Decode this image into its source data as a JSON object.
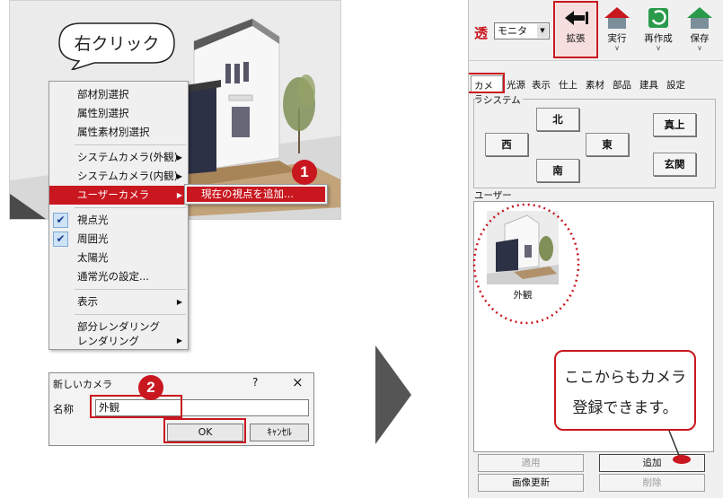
{
  "bubble": {
    "text": "右クリック"
  },
  "context_menu": {
    "items": [
      {
        "label": "部材別選択"
      },
      {
        "label": "属性別選択"
      },
      {
        "label": "属性素材別選択"
      },
      {
        "label": "システムカメラ(外観)",
        "submenu": true
      },
      {
        "label": "システムカメラ(内観)",
        "submenu": true
      },
      {
        "label": "ユーザーカメラ",
        "submenu": true,
        "selected": true
      },
      {
        "label": "視点光",
        "checked": true
      },
      {
        "label": "周囲光",
        "checked": true
      },
      {
        "label": "太陽光"
      },
      {
        "label": "通常光の設定..."
      },
      {
        "label": "表示",
        "submenu": true
      },
      {
        "label": "部分レンダリング"
      },
      {
        "label": "レンダリング",
        "submenu": true
      }
    ],
    "submenu_item": "現在の視点を追加..."
  },
  "markers": {
    "step1": "1",
    "step2": "2"
  },
  "dialog": {
    "title": "新しいカメラ",
    "help": "?",
    "close": "×",
    "name_label": "名称",
    "name_value": "外観",
    "ok": "OK",
    "cancel": "ｷｬﾝｾﾙ"
  },
  "toolbar": {
    "transparent": "透",
    "monitor": "モニタ",
    "buttons": [
      {
        "label": "拡張",
        "icon": "back-arrow-icon"
      },
      {
        "label": "実行",
        "icon": "house-icon"
      },
      {
        "label": "再作成",
        "icon": "refresh-icon"
      },
      {
        "label": "保存",
        "icon": "house-save-icon"
      }
    ]
  },
  "tabs": [
    "カメラ",
    "光源",
    "表示",
    "仕上",
    "素材",
    "部品",
    "建具",
    "設定"
  ],
  "system_group": {
    "label": "システム",
    "buttons": {
      "north": "北",
      "west": "西",
      "east": "東",
      "south": "南",
      "top": "真上",
      "entrance": "玄関"
    }
  },
  "user_group": {
    "label": "ユーザー",
    "thumbnail_label": "外観"
  },
  "callout": {
    "line1": "ここからもカメラ",
    "line2": "登録できます。"
  },
  "bottom_buttons": {
    "apply": "適用",
    "add": "追加",
    "update_image": "画像更新",
    "delete": "削除"
  },
  "colors": {
    "accent": "#c9171f"
  }
}
